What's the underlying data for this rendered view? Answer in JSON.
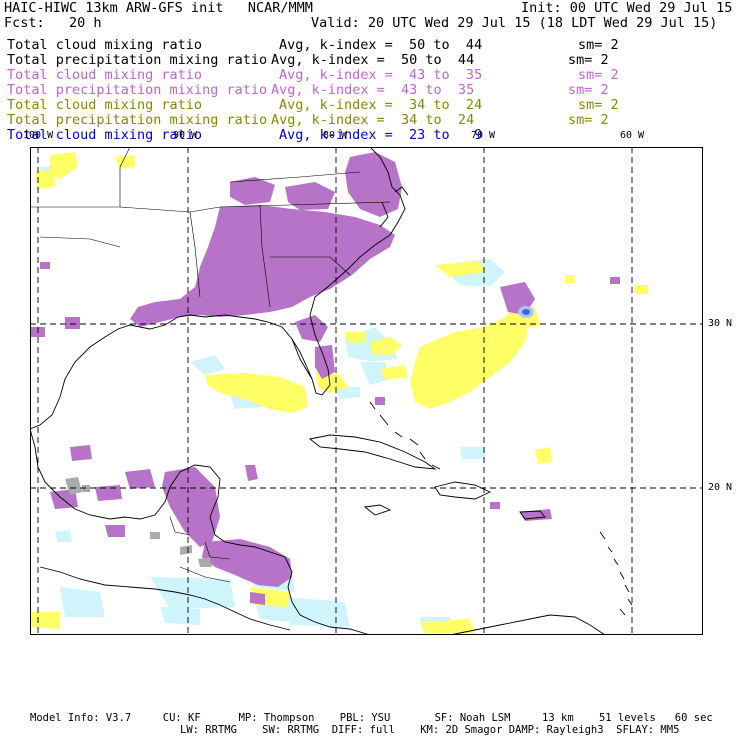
{
  "header": {
    "title_left": "HAIC-HIWC 13km ARW-GFS init   NCAR/MMM",
    "init": "Init: 00 UTC Wed 29 Jul 15",
    "fcst": "Fcst:   20 h",
    "valid": "Valid: 20 UTC Wed 29 Jul 15 (18 LDT Wed 29 Jul 15)"
  },
  "legend": [
    {
      "name": "Total cloud mixing ratio",
      "range": "Avg, k-index =  50 to  44",
      "sm": "sm= 2",
      "color": "#000000"
    },
    {
      "name": "Total precipitation mixing ratio",
      "range": "Avg, k-index =  50 to  44",
      "sm": "sm= 2",
      "color": "#000000"
    },
    {
      "name": "Total cloud mixing ratio",
      "range": "Avg, k-index =  43 to  35",
      "sm": "sm= 2",
      "color": "#bb66cc"
    },
    {
      "name": "Total precipitation mixing ratio",
      "range": "Avg, k-index =  43 to  35",
      "sm": "sm= 2",
      "color": "#bb66cc"
    },
    {
      "name": "Total cloud mixing ratio",
      "range": "Avg, k-index =  34 to  24",
      "sm": "sm= 2",
      "color": "#888800"
    },
    {
      "name": "Total precipitation mixing ratio",
      "range": "Avg, k-index =  34 to  24",
      "sm": "sm= 2",
      "color": "#888800"
    },
    {
      "name": "Total cloud mixing ratio",
      "range": "Avg, k-index =  23 to   9",
      "sm": "",
      "color": "#0000dd"
    }
  ],
  "axes": {
    "lon_labels": [
      "100 W",
      "90 W",
      "80 W",
      "70 W",
      "60 W"
    ],
    "lat_labels": [
      "30 N",
      "20 N"
    ]
  },
  "footer": {
    "line1": "Model Info: V3.7     CU: KF      MP: Thompson    PBL: YSU       SF: Noah LSM     13 km    51 levels   60 sec",
    "line2": "LW: RRTMG    SW: RRTMG  DIFF: full    KM: 2D Smagor DAMP: Rayleigh3  SFLAY: MM5"
  },
  "colors": {
    "purple": "#b673c8",
    "yellow": "#ffff66",
    "cyan": "#cff4fb",
    "gray": "#aaaaaa",
    "blue": "#3b66f0",
    "coast": "#000000"
  }
}
